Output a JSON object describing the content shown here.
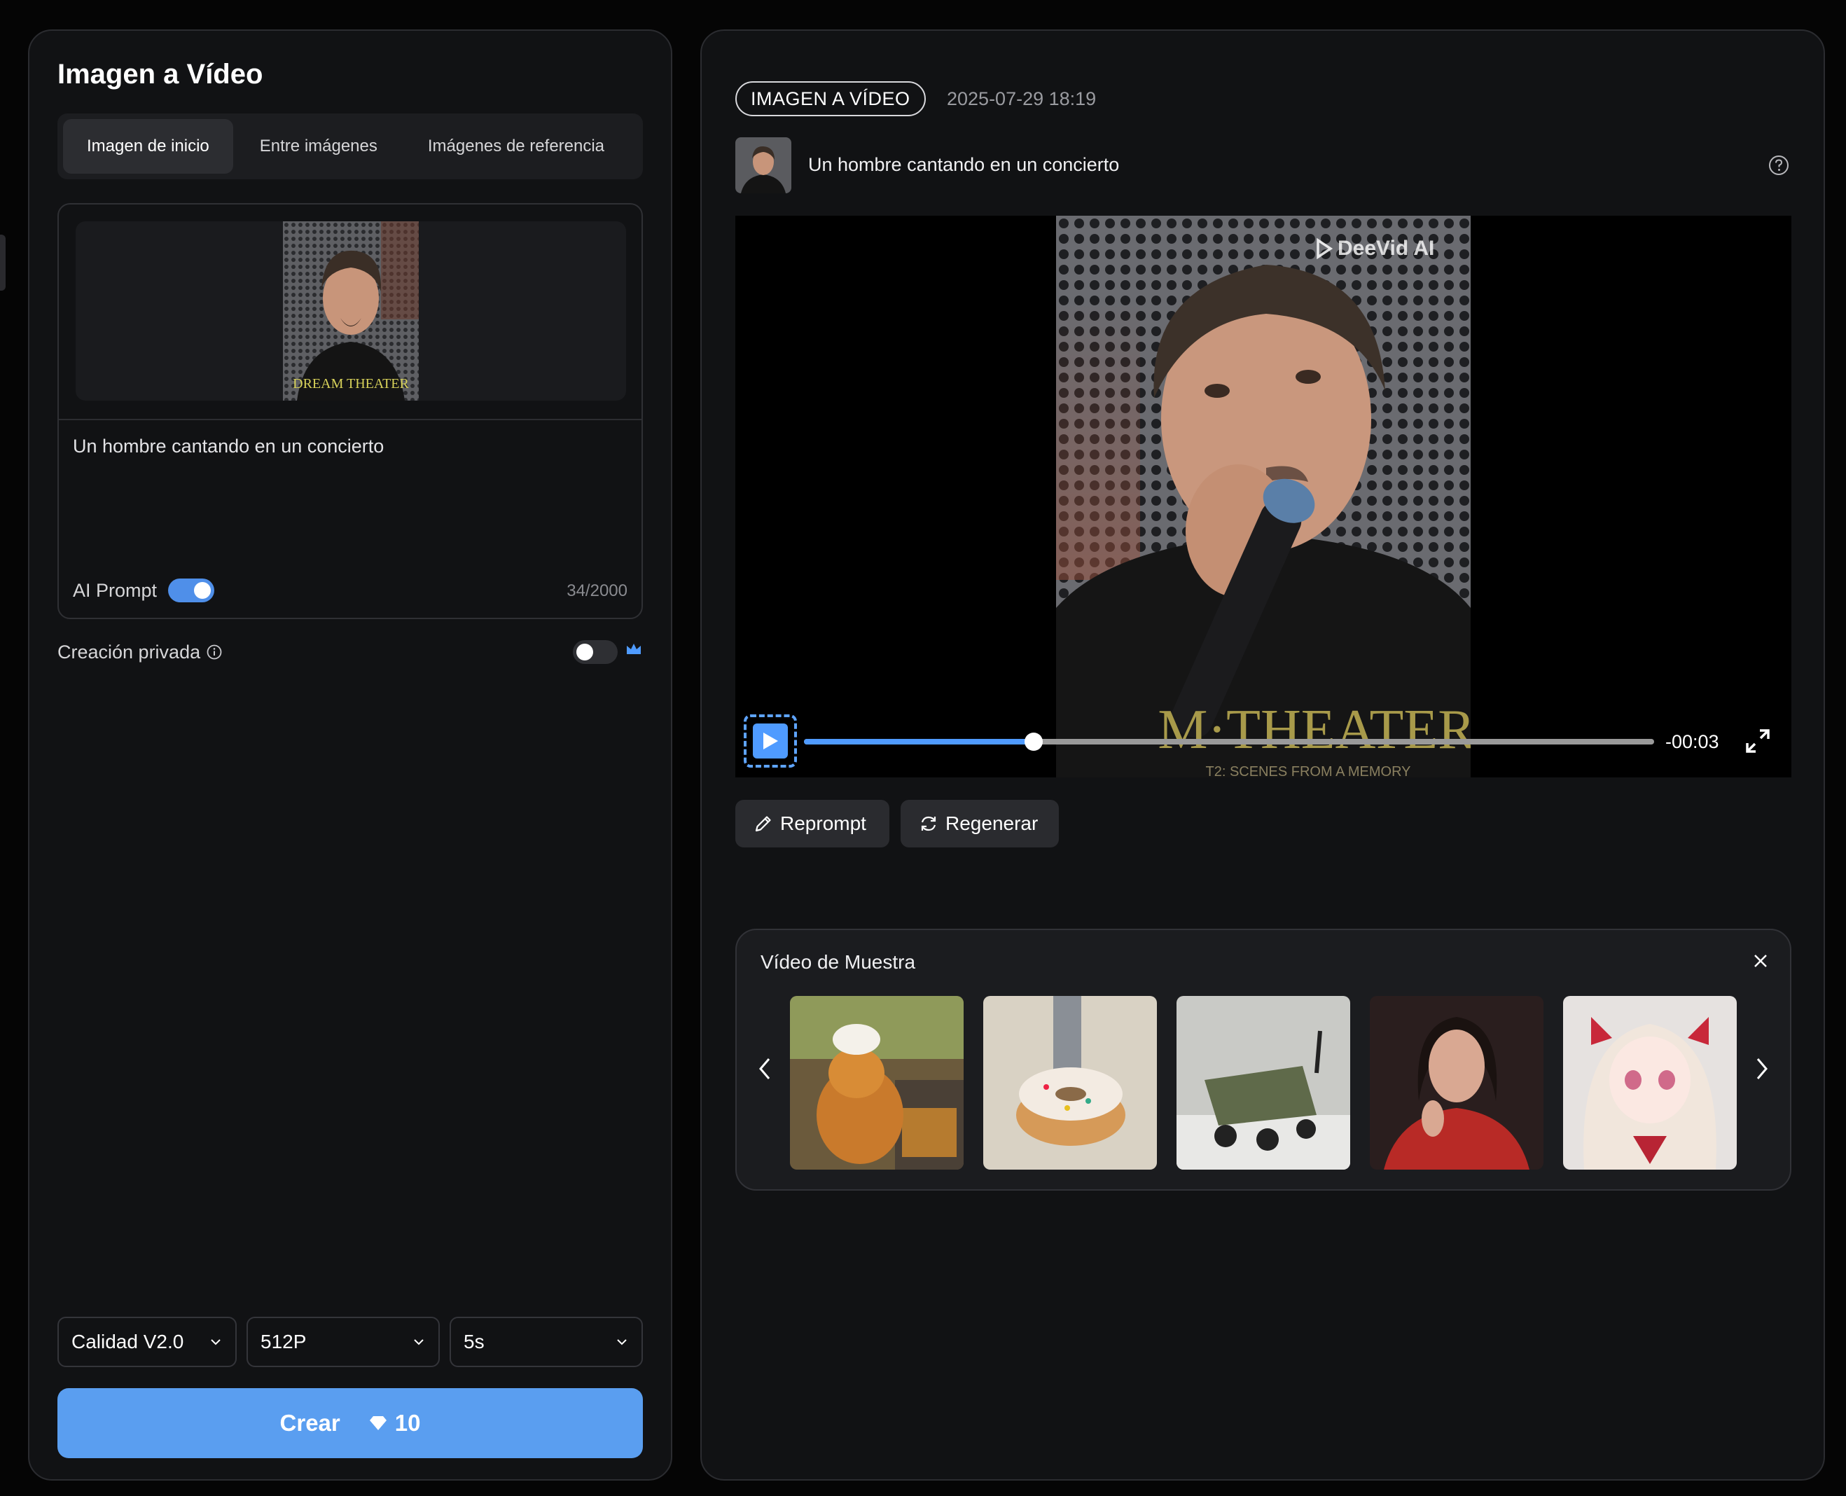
{
  "left": {
    "title": "Imagen a Vídeo",
    "tabs": [
      {
        "label": "Imagen de inicio",
        "active": true
      },
      {
        "label": "Entre imágenes",
        "active": false
      },
      {
        "label": "Imágenes de referencia",
        "active": false
      }
    ],
    "prompt": "Un hombre cantando en un concierto",
    "ai_prompt_label": "AI Prompt",
    "ai_prompt_enabled": true,
    "char_count": "34/2000",
    "private_label": "Creación privada",
    "private_enabled": false,
    "selects": {
      "quality": "Calidad V2.0",
      "resolution": "512P",
      "duration": "5s"
    },
    "create": {
      "label": "Crear",
      "cost": "10"
    }
  },
  "right": {
    "badge": "IMAGEN A VÍDEO",
    "timestamp": "2025-07-29 18:19",
    "video_title": "Un hombre cantando en un concierto",
    "watermark": "DeeVid AI",
    "player": {
      "remaining": "-00:03",
      "progress_fraction": 0.27
    },
    "actions": {
      "reprompt": "Reprompt",
      "regenerate": "Regenerar"
    },
    "samples": {
      "title": "Vídeo de Muestra",
      "items": [
        "cat-baker",
        "donut-robot",
        "camping-wagon",
        "woman-red-sweater",
        "anime-girl"
      ]
    }
  },
  "colors": {
    "accent": "#5a9ef0",
    "panel": "#111214",
    "background": "#050505"
  }
}
